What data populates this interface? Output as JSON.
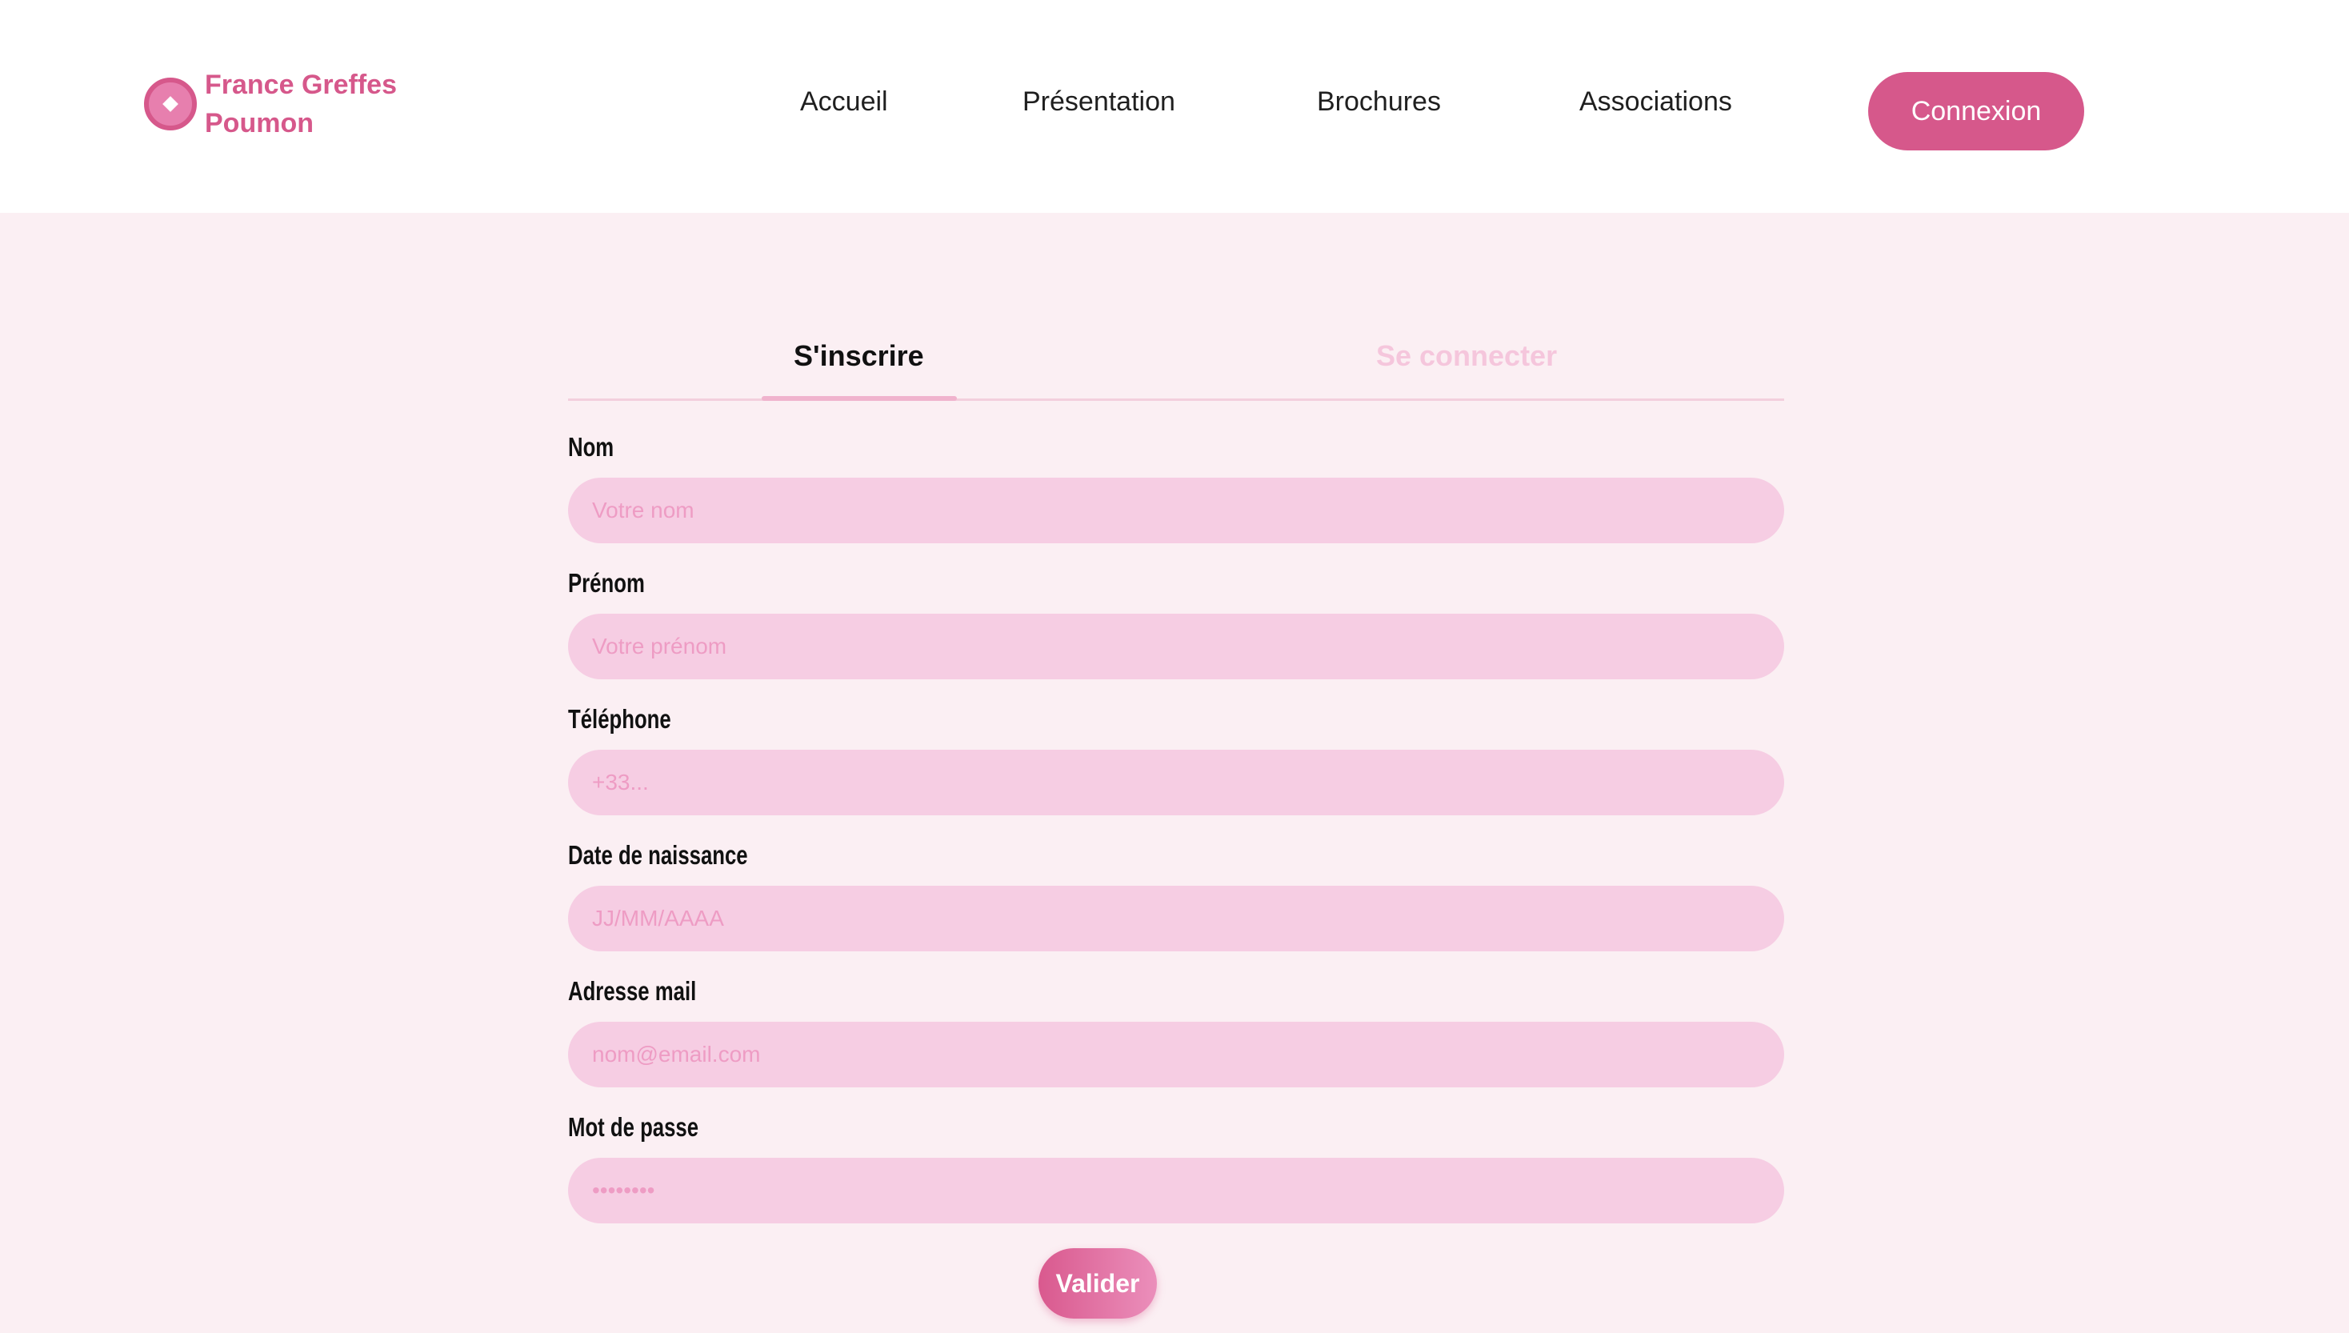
{
  "brand": {
    "line1": "France Greffes",
    "line2": "Poumon",
    "logo_icon": "lung-heart-logo-icon",
    "color": "#d6588b"
  },
  "nav": {
    "items": [
      {
        "label": "Accueil"
      },
      {
        "label": "Présentation"
      },
      {
        "label": "Brochures"
      },
      {
        "label": "Associations"
      }
    ],
    "login_button": "Connexion"
  },
  "tabs": {
    "signup": "S'inscrire",
    "login": "Se connecter",
    "active": "signup"
  },
  "form": {
    "fields": [
      {
        "label": "Nom",
        "placeholder": "Votre nom",
        "type": "text"
      },
      {
        "label": "Prénom",
        "placeholder": "Votre prénom",
        "type": "text"
      },
      {
        "label": "Téléphone",
        "placeholder": "+33...",
        "type": "tel"
      },
      {
        "label": "Date de naissance",
        "placeholder": "JJ/MM/AAAA",
        "type": "text"
      },
      {
        "label": "Adresse mail",
        "placeholder": "nom@email.com",
        "type": "email"
      },
      {
        "label": "Mot de passe",
        "placeholder": "••••••••",
        "type": "password"
      }
    ],
    "submit": "Valider"
  },
  "colors": {
    "accent": "#d6588b",
    "page_background": "#fbeff3",
    "input_background": "#f6cde3",
    "inactive_tab": "#f5c6dc"
  }
}
